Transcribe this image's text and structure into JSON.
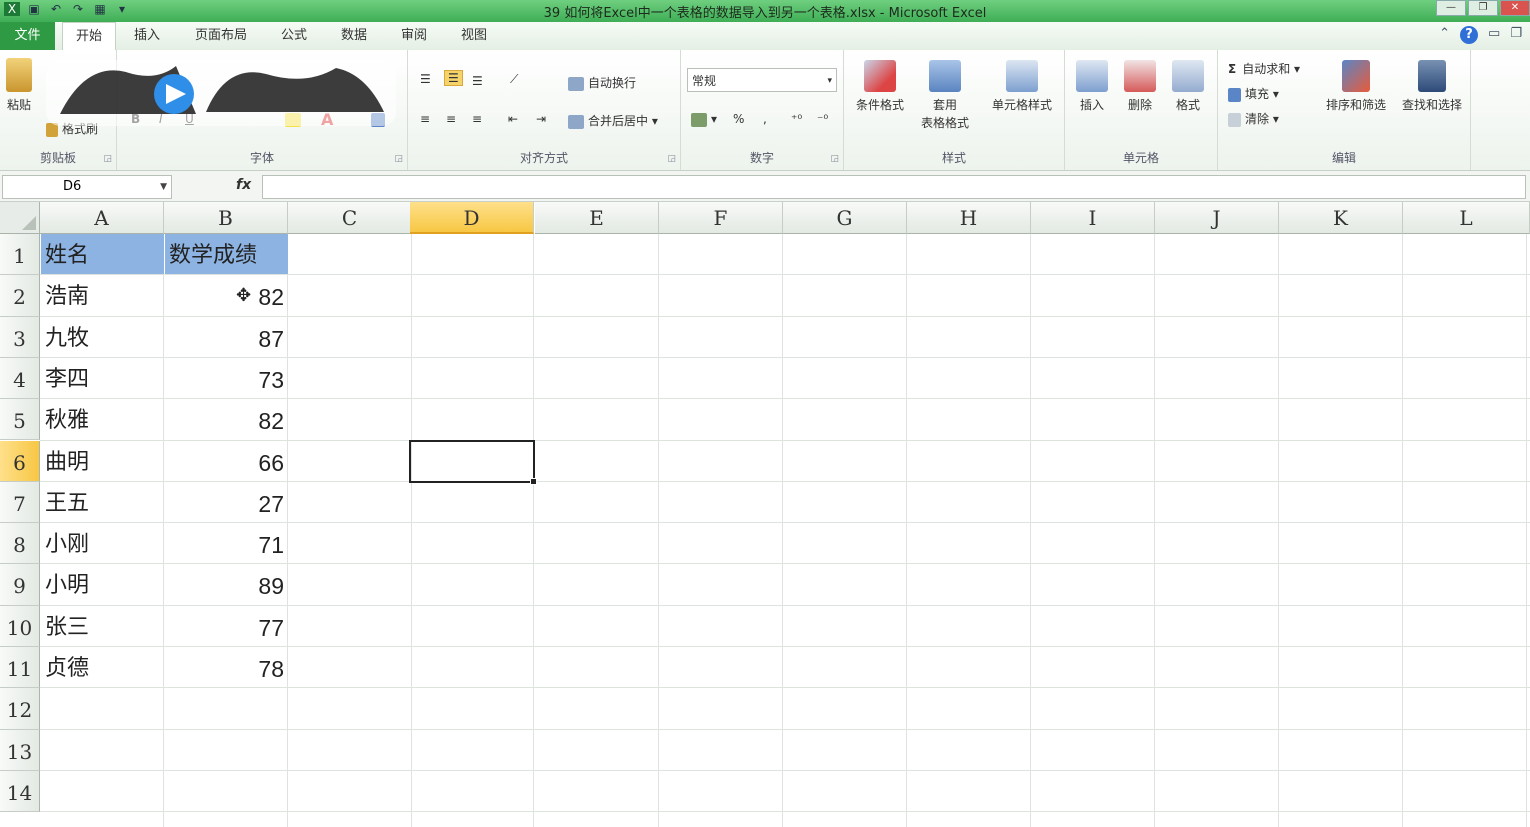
{
  "window": {
    "title": "39 如何将Excel中一个表格的数据导入到另一个表格.xlsx - Microsoft Excel",
    "controls": {
      "minimize": "—",
      "restore": "❐",
      "close": "✕"
    }
  },
  "tabs": [
    {
      "label": "文件"
    },
    {
      "label": "开始"
    },
    {
      "label": "插入"
    },
    {
      "label": "页面布局"
    },
    {
      "label": "公式"
    },
    {
      "label": "数据"
    },
    {
      "label": "审阅"
    },
    {
      "label": "视图"
    }
  ],
  "ribbon": {
    "clipboard": {
      "label": "剪贴板",
      "paste": "粘贴",
      "format_painter": "格式刷"
    },
    "font": {
      "label": "字体",
      "bold": "B",
      "italic": "I",
      "underline": "U"
    },
    "alignment": {
      "label": "对齐方式",
      "wrap": "自动换行",
      "merge": "合并后居中"
    },
    "number": {
      "label": "数字",
      "format": "常规",
      "percent": "%",
      "comma": ","
    },
    "styles": {
      "label": "样式",
      "conditional": "条件格式",
      "table_format_1": "套用",
      "table_format_2": "表格格式",
      "cell_styles": "单元格样式"
    },
    "cells": {
      "label": "单元格",
      "insert": "插入",
      "delete": "删除",
      "format": "格式"
    },
    "editing": {
      "label": "编辑",
      "autosum": "自动求和",
      "fill": "填充",
      "clear": "清除",
      "sort": "排序和筛选",
      "find": "查找和选择"
    }
  },
  "formula_bar": {
    "name_box": "D6",
    "fx": "fx",
    "content": ""
  },
  "columns": [
    "A",
    "B",
    "C",
    "D",
    "E",
    "F",
    "G",
    "H",
    "I",
    "J",
    "K",
    "L"
  ],
  "rows": [
    "1",
    "2",
    "3",
    "4",
    "5",
    "6",
    "7",
    "8",
    "9",
    "10",
    "11",
    "12",
    "13",
    "14"
  ],
  "selected": {
    "cell": "D6",
    "column": "D",
    "row": "6"
  },
  "sheet": {
    "header": {
      "name": "姓名",
      "score": "数学成绩"
    },
    "data": [
      {
        "name": "浩南",
        "score": "82"
      },
      {
        "name": "九牧",
        "score": "87"
      },
      {
        "name": "李四",
        "score": "73"
      },
      {
        "name": "秋雅",
        "score": "82"
      },
      {
        "name": "曲明",
        "score": "66"
      },
      {
        "name": "王五",
        "score": "27"
      },
      {
        "name": "小刚",
        "score": "71"
      },
      {
        "name": "小明",
        "score": "89"
      },
      {
        "name": "张三",
        "score": "77"
      },
      {
        "name": "贞德",
        "score": "78"
      }
    ]
  },
  "colors": {
    "header_fill": "#8db3e2",
    "selection_header": "#f7c744",
    "file_tab": "#2f9a44"
  }
}
